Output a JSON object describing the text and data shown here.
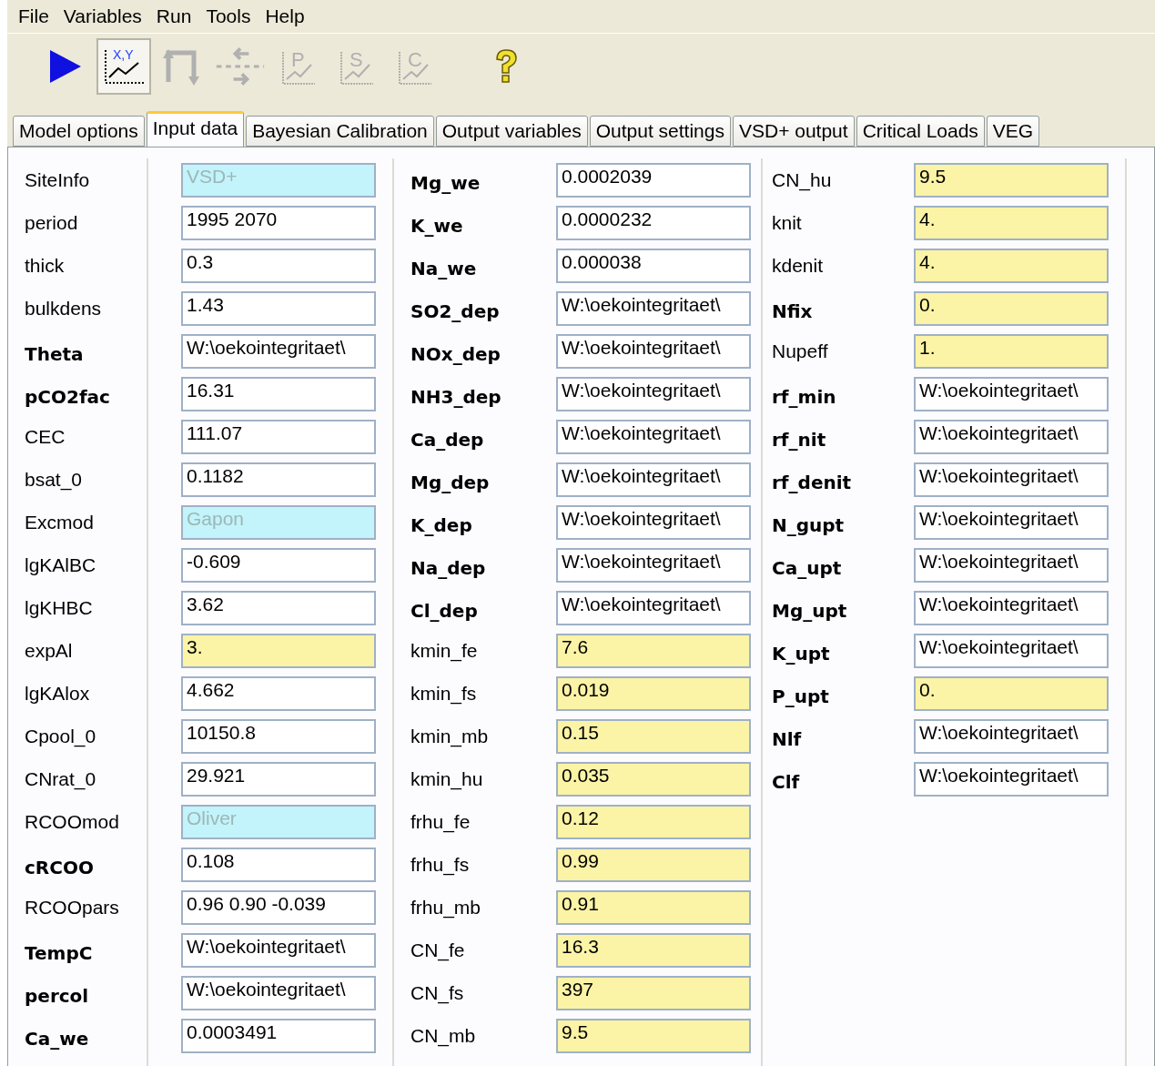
{
  "menu": [
    "File",
    "Variables",
    "Run",
    "Tools",
    "Help"
  ],
  "toolbar": [
    {
      "kind": "run",
      "pressed": false,
      "disabled": false
    },
    {
      "kind": "xychart",
      "label": "X,Y",
      "pressed": true,
      "disabled": false
    },
    {
      "kind": "loop",
      "pressed": false,
      "disabled": true
    },
    {
      "kind": "split",
      "pressed": false,
      "disabled": true
    },
    {
      "kind": "letterchart",
      "label": "P",
      "pressed": false,
      "disabled": true
    },
    {
      "kind": "letterchart",
      "label": "S",
      "pressed": false,
      "disabled": true
    },
    {
      "kind": "letterchart",
      "label": "C",
      "pressed": false,
      "disabled": true
    },
    {
      "kind": "help",
      "pressed": false,
      "disabled": false
    }
  ],
  "tabs": [
    {
      "label": "Model options",
      "selected": false
    },
    {
      "label": "Input data",
      "selected": true
    },
    {
      "label": "Bayesian Calibration",
      "selected": false
    },
    {
      "label": "Output variables",
      "selected": false
    },
    {
      "label": "Output settings",
      "selected": false
    },
    {
      "label": "VSD+ output",
      "selected": false
    },
    {
      "label": "Critical Loads",
      "selected": false
    },
    {
      "label": "VEG",
      "selected": false
    }
  ],
  "columns": [
    [
      {
        "label": "SiteInfo",
        "bold": false,
        "value": "VSD+",
        "kind": "fixed"
      },
      {
        "label": "period",
        "bold": false,
        "value": "1995 2070",
        "kind": "plain"
      },
      {
        "label": "thick",
        "bold": false,
        "value": "0.3",
        "kind": "plain"
      },
      {
        "label": "bulkdens",
        "bold": false,
        "value": "1.43",
        "kind": "plain"
      },
      {
        "label": "Theta",
        "bold": true,
        "value": "W:\\oekointegritaet\\",
        "kind": "plain"
      },
      {
        "label": "pCO2fac",
        "bold": true,
        "value": "16.31",
        "kind": "plain"
      },
      {
        "label": "CEC",
        "bold": false,
        "value": "111.07",
        "kind": "plain"
      },
      {
        "label": "bsat_0",
        "bold": false,
        "value": "0.1182",
        "kind": "plain"
      },
      {
        "label": "Excmod",
        "bold": false,
        "value": "Gapon",
        "kind": "fixed"
      },
      {
        "label": "lgKAlBC",
        "bold": false,
        "value": "-0.609",
        "kind": "plain"
      },
      {
        "label": "lgKHBC",
        "bold": false,
        "value": "3.62",
        "kind": "plain"
      },
      {
        "label": "expAl",
        "bold": false,
        "value": "3.",
        "kind": "calib"
      },
      {
        "label": "lgKAlox",
        "bold": false,
        "value": "4.662",
        "kind": "plain"
      },
      {
        "label": "Cpool_0",
        "bold": false,
        "value": "10150.8",
        "kind": "plain"
      },
      {
        "label": "CNrat_0",
        "bold": false,
        "value": "29.921",
        "kind": "plain"
      },
      {
        "label": "RCOOmod",
        "bold": false,
        "value": "Oliver",
        "kind": "fixed"
      },
      {
        "label": "cRCOO",
        "bold": true,
        "value": "0.108",
        "kind": "plain"
      },
      {
        "label": "RCOOpars",
        "bold": false,
        "value": "0.96 0.90 -0.039",
        "kind": "plain"
      },
      {
        "label": "TempC",
        "bold": true,
        "value": "W:\\oekointegritaet\\",
        "kind": "plain"
      },
      {
        "label": "percol",
        "bold": true,
        "value": "W:\\oekointegritaet\\",
        "kind": "plain"
      },
      {
        "label": "Ca_we",
        "bold": true,
        "value": "0.0003491",
        "kind": "plain"
      }
    ],
    [
      {
        "label": "Mg_we",
        "bold": true,
        "value": "0.0002039",
        "kind": "plain"
      },
      {
        "label": "K_we",
        "bold": true,
        "value": "0.0000232",
        "kind": "plain"
      },
      {
        "label": "Na_we",
        "bold": true,
        "value": "0.000038",
        "kind": "plain"
      },
      {
        "label": "SO2_dep",
        "bold": true,
        "value": "W:\\oekointegritaet\\",
        "kind": "plain"
      },
      {
        "label": "NOx_dep",
        "bold": true,
        "value": "W:\\oekointegritaet\\",
        "kind": "plain"
      },
      {
        "label": "NH3_dep",
        "bold": true,
        "value": "W:\\oekointegritaet\\",
        "kind": "plain"
      },
      {
        "label": "Ca_dep",
        "bold": true,
        "value": "W:\\oekointegritaet\\",
        "kind": "plain"
      },
      {
        "label": "Mg_dep",
        "bold": true,
        "value": "W:\\oekointegritaet\\",
        "kind": "plain"
      },
      {
        "label": "K_dep",
        "bold": true,
        "value": "W:\\oekointegritaet\\",
        "kind": "plain"
      },
      {
        "label": "Na_dep",
        "bold": true,
        "value": "W:\\oekointegritaet\\",
        "kind": "plain"
      },
      {
        "label": "Cl_dep",
        "bold": true,
        "value": "W:\\oekointegritaet\\",
        "kind": "plain"
      },
      {
        "label": "kmin_fe",
        "bold": false,
        "value": "7.6",
        "kind": "calib"
      },
      {
        "label": "kmin_fs",
        "bold": false,
        "value": "0.019",
        "kind": "calib"
      },
      {
        "label": "kmin_mb",
        "bold": false,
        "value": "0.15",
        "kind": "calib"
      },
      {
        "label": "kmin_hu",
        "bold": false,
        "value": "0.035",
        "kind": "calib"
      },
      {
        "label": "frhu_fe",
        "bold": false,
        "value": "0.12",
        "kind": "calib"
      },
      {
        "label": "frhu_fs",
        "bold": false,
        "value": "0.99",
        "kind": "calib"
      },
      {
        "label": "frhu_mb",
        "bold": false,
        "value": "0.91",
        "kind": "calib"
      },
      {
        "label": "CN_fe",
        "bold": false,
        "value": "16.3",
        "kind": "calib"
      },
      {
        "label": "CN_fs",
        "bold": false,
        "value": "397",
        "kind": "calib"
      },
      {
        "label": "CN_mb",
        "bold": false,
        "value": "9.5",
        "kind": "calib"
      }
    ],
    [
      {
        "label": "CN_hu",
        "bold": false,
        "value": "9.5",
        "kind": "calib"
      },
      {
        "label": "knit",
        "bold": false,
        "value": "4.",
        "kind": "calib"
      },
      {
        "label": "kdenit",
        "bold": false,
        "value": "4.",
        "kind": "calib"
      },
      {
        "label": "Nfix",
        "bold": true,
        "value": "0.",
        "kind": "calib"
      },
      {
        "label": "Nupeff",
        "bold": false,
        "value": "1.",
        "kind": "calib"
      },
      {
        "label": "rf_min",
        "bold": true,
        "value": "W:\\oekointegritaet\\",
        "kind": "plain"
      },
      {
        "label": "rf_nit",
        "bold": true,
        "value": "W:\\oekointegritaet\\",
        "kind": "plain"
      },
      {
        "label": "rf_denit",
        "bold": true,
        "value": "W:\\oekointegritaet\\",
        "kind": "plain"
      },
      {
        "label": "N_gupt",
        "bold": true,
        "value": "W:\\oekointegritaet\\",
        "kind": "plain"
      },
      {
        "label": "Ca_upt",
        "bold": true,
        "value": "W:\\oekointegritaet\\",
        "kind": "plain"
      },
      {
        "label": "Mg_upt",
        "bold": true,
        "value": "W:\\oekointegritaet\\",
        "kind": "plain"
      },
      {
        "label": "K_upt",
        "bold": true,
        "value": "W:\\oekointegritaet\\",
        "kind": "plain"
      },
      {
        "label": "P_upt",
        "bold": true,
        "value": "0.",
        "kind": "calib"
      },
      {
        "label": "Nlf",
        "bold": true,
        "value": "W:\\oekointegritaet\\",
        "kind": "plain"
      },
      {
        "label": "Clf",
        "bold": true,
        "value": "W:\\oekointegritaet\\",
        "kind": "plain"
      }
    ]
  ]
}
